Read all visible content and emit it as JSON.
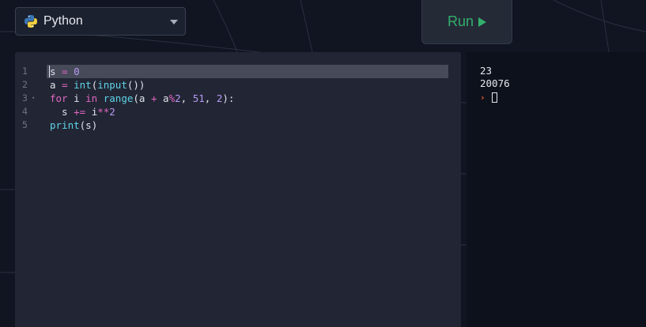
{
  "header": {
    "language": {
      "label": "Python",
      "icon": "python-icon"
    },
    "run_button": {
      "label": "Run",
      "icon": "play-icon",
      "color": "#32b06b"
    }
  },
  "editor": {
    "lines": [
      {
        "number": "1",
        "text": "s = 0"
      },
      {
        "number": "2",
        "text": "a = int(input())"
      },
      {
        "number": "3",
        "text": "for i in range(a + a%2, 51, 2):"
      },
      {
        "number": "4",
        "text": "  s += i**2"
      },
      {
        "number": "5",
        "text": "print(s)"
      }
    ]
  },
  "console": {
    "lines": [
      "23",
      "20076"
    ],
    "prompt_icon": "prompt-chevron-icon"
  }
}
